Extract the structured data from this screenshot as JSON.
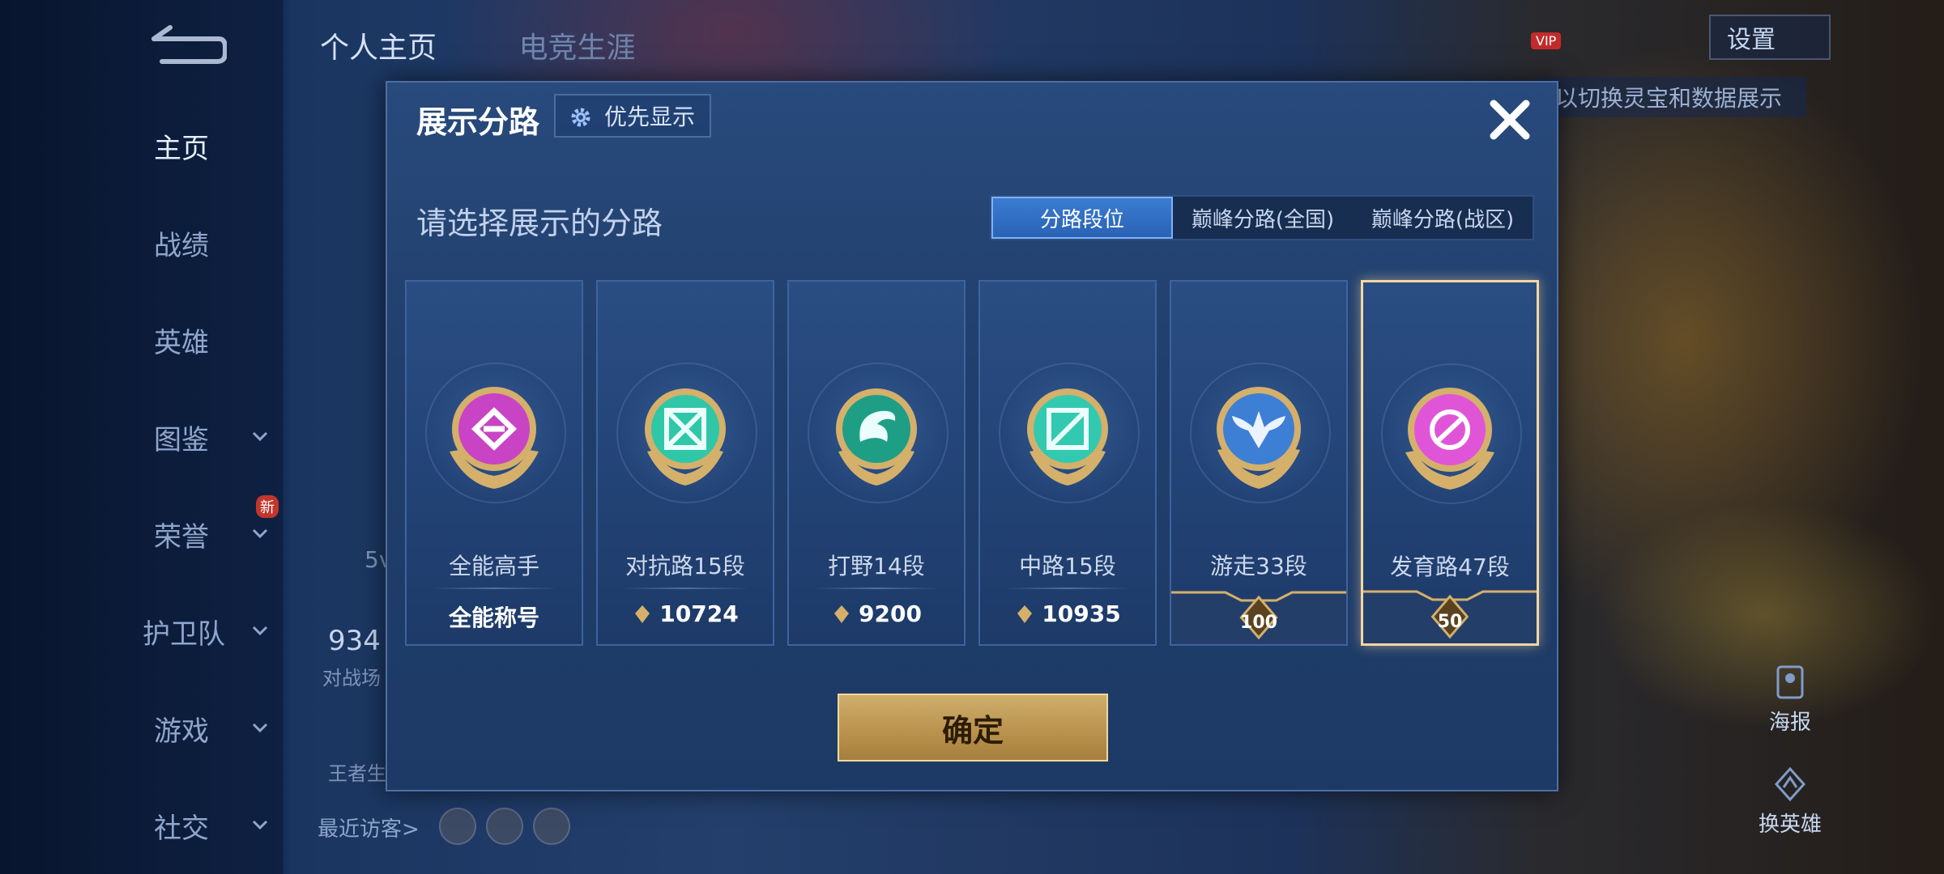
{
  "sidebar": {
    "items": [
      {
        "label": "主页"
      },
      {
        "label": "战绩"
      },
      {
        "label": "英雄"
      },
      {
        "label": "图鉴"
      },
      {
        "label": "荣誉"
      },
      {
        "label": "护卫队"
      },
      {
        "label": "游戏"
      },
      {
        "label": "社交"
      }
    ],
    "new_badge": "新"
  },
  "header": {
    "tab_profile": "个人主页",
    "tab_esports": "电竞生涯",
    "settings_label": "设置",
    "vip_label": "VIP",
    "hint_text": "以切换灵宝和数据展示"
  },
  "background_profile": {
    "mode_label": "5v",
    "number": "934",
    "sub_label": "对战场",
    "king_label": "王者生",
    "recent_visitors_label": "最近访客>",
    "poster_label": "海报",
    "change_hero_label": "换英雄"
  },
  "modal": {
    "title": "展示分路",
    "priority_label": "优先显示",
    "prompt": "请选择展示的分路",
    "tabs": [
      "分路段位",
      "巅峰分路(全国)",
      "巅峰分路(战区)"
    ],
    "active_tab": 0,
    "confirm_label": "确定",
    "cards": [
      {
        "name": "全能高手",
        "value": "全能称号",
        "emblem": "all-rounder-emblem",
        "color": "#c944c4",
        "selected": false
      },
      {
        "name": "对抗路15段",
        "value": "10724",
        "emblem": "clash-lane-emblem",
        "color": "#2fc7a8",
        "selected": false
      },
      {
        "name": "打野14段",
        "value": "9200",
        "emblem": "jungle-emblem",
        "color": "#1f9e86",
        "selected": false
      },
      {
        "name": "中路15段",
        "value": "10935",
        "emblem": "mid-lane-emblem",
        "color": "#33c9b0",
        "selected": false
      },
      {
        "name": "游走33段",
        "value": "100",
        "emblem": "roam-emblem",
        "color": "#3e7fd6",
        "selected": false
      },
      {
        "name": "发育路47段",
        "value": "50",
        "emblem": "farm-lane-emblem",
        "color": "#e055d8",
        "selected": true
      }
    ]
  },
  "colors": {
    "accent_gold": "#d4b06a",
    "tab_active_blue": "#2f6fc4",
    "selected_border": "#f3d7a2"
  }
}
